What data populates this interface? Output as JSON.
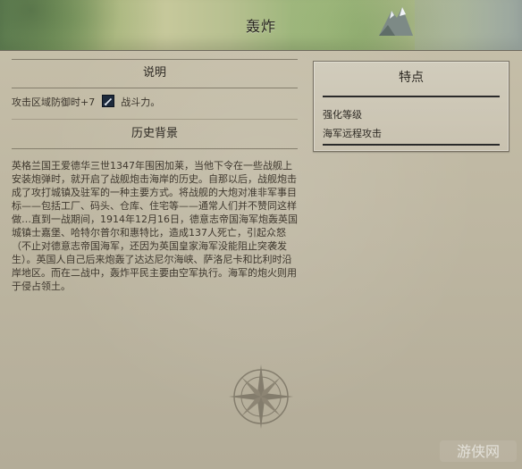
{
  "header": {
    "title": "轰炸"
  },
  "description": {
    "heading": "说明",
    "text_before": "攻击区域防御时+7",
    "icon": "sword-icon",
    "text_after": "战斗力。"
  },
  "history": {
    "heading": "历史背景",
    "text": "英格兰国王爱德华三世1347年围困加莱，当他下令在一些战舰上安装炮弹时，就开启了战舰炮击海岸的历史。自那以后，战舰炮击成了攻打城镇及驻军的一种主要方式。将战舰的大炮对准非军事目标——包括工厂、码头、仓库、住宅等——通常人们并不赞同这样做…直到一战期间，1914年12月16日，德意志帝国海军炮轰英国城镇士嘉堡、哈特尔普尔和惠特比，造成137人死亡，引起众怒（不止对德意志帝国海军，还因为英国皇家海军没能阻止突袭发生）。英国人自己后来炮轰了达达尼尔海峡、萨洛尼卡和比利时沿岸地区。而在二战中，轰炸平民主要由空军执行。海军的炮火则用于侵占领土。"
  },
  "features": {
    "title": "特点",
    "items": [
      "强化等级",
      "海军远程攻击"
    ]
  },
  "watermark": {
    "text": "游侠网"
  },
  "colors": {
    "background": "#bdb6a1",
    "text": "#3a3328",
    "accent_dark": "#2a2a2a"
  }
}
